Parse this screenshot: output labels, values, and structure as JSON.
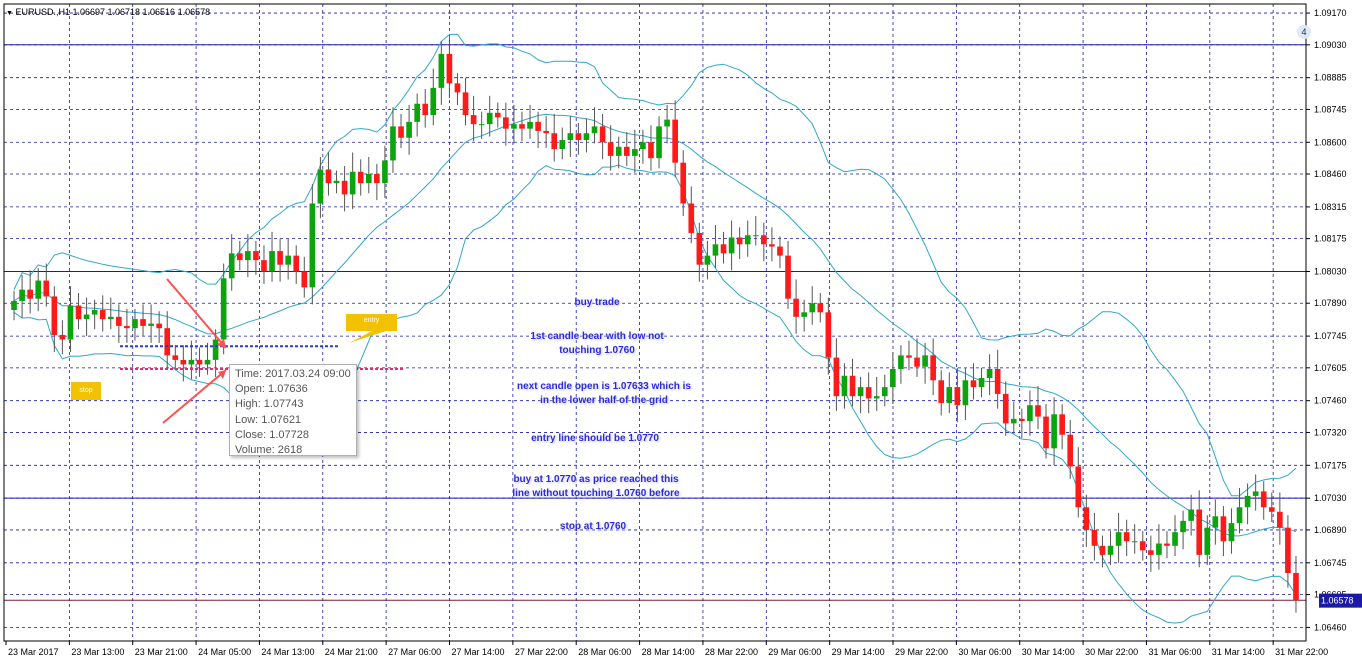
{
  "window": {
    "symbol": "EURUSD.",
    "timeframe": "H1",
    "title": "EURUSD.,H1  1.06697 1.06718 1.06516 1.06578",
    "chart_number": "4"
  },
  "colors": {
    "background": "#ffffff",
    "grid": "#1a1aa6",
    "bull": "#0da30d",
    "bear": "#ff1a1a",
    "bands": "#30a8c8",
    "current_price_bg": "#1a1aa6",
    "annotation_text": "#2b2bd6",
    "arrow": "#ff5050",
    "tag": "#f2c200"
  },
  "price_axis": {
    "labels": [
      "1.09170",
      "1.09030",
      "1.08885",
      "1.08745",
      "1.08600",
      "1.08460",
      "1.08315",
      "1.08175",
      "1.08030",
      "1.07890",
      "1.07745",
      "1.07605",
      "1.07460",
      "1.07320",
      "1.07175",
      "1.07030",
      "1.06890",
      "1.06745",
      "1.06605",
      "1.06460"
    ],
    "current_price": "1.06578",
    "range": [
      1.064,
      1.0921
    ]
  },
  "time_axis": {
    "labels": [
      "23 Mar 2017",
      "23 Mar 13:00",
      "23 Mar 21:00",
      "24 Mar 05:00",
      "24 Mar 13:00",
      "24 Mar 21:00",
      "27 Mar 06:00",
      "27 Mar 14:00",
      "27 Mar 22:00",
      "28 Mar 06:00",
      "28 Mar 14:00",
      "28 Mar 22:00",
      "29 Mar 06:00",
      "29 Mar 14:00",
      "29 Mar 22:00",
      "30 Mar 06:00",
      "30 Mar 14:00",
      "30 Mar 22:00",
      "31 Mar 06:00",
      "31 Mar 14:00",
      "31 Mar 22:00"
    ]
  },
  "horizontal_lines": [
    1.0903,
    1.0803,
    1.0703,
    1.0658
  ],
  "tooltip": {
    "time": "Time: 2017.03.24 09:00",
    "open": "Open: 1.07636",
    "high": "High: 1.07743",
    "low": "Low:  1.07621",
    "close": "Close: 1.07728",
    "volume": "Volume: 2618"
  },
  "annotations": {
    "buy_trade": "buy trade",
    "first_candle_1": "1st candle bear with low not",
    "first_candle_2": "touching 1.0760",
    "next_candle_1": "next candle open is 1.07633 which is",
    "next_candle_2": "in the lower half of the grid",
    "entry_line": "entry line should be 1.0770",
    "buy_at_1": "buy at 1.0770 as price reached this",
    "buy_at_2": "line without touching 1.0760 before",
    "stop_at": "stop at 1.0760",
    "entry_tag": "entry",
    "stop_tag": "stop"
  },
  "levels": {
    "entry": 1.077,
    "stop": 1.076
  },
  "chart_data": {
    "type": "candlestick",
    "symbol": "EURUSD.",
    "timeframe": "H1",
    "ohlc_last": {
      "open": 1.06697,
      "high": 1.06718,
      "low": 1.06516,
      "close": 1.06578
    },
    "ylim": [
      1.064,
      1.0921
    ],
    "close_series": [
      1.079,
      1.0795,
      1.0791,
      1.0799,
      1.0792,
      1.0775,
      1.0773,
      1.0788,
      1.0782,
      1.0784,
      1.0786,
      1.0782,
      1.0783,
      1.0779,
      1.0778,
      1.0782,
      1.0779,
      1.078,
      1.0778,
      1.0766,
      1.0764,
      1.0762,
      1.0764,
      1.0762,
      1.0764,
      1.0773,
      1.08,
      1.0811,
      1.0808,
      1.0812,
      1.0808,
      1.0803,
      1.0812,
      1.0806,
      1.081,
      1.0803,
      1.0796,
      1.0833,
      1.0848,
      1.0842,
      1.0843,
      1.0837,
      1.0847,
      1.0842,
      1.0846,
      1.0842,
      1.0852,
      1.0867,
      1.0862,
      1.0869,
      1.0877,
      1.0872,
      1.0884,
      1.0899,
      1.0886,
      1.0882,
      1.0872,
      1.0868,
      1.0868,
      1.0873,
      1.0871,
      1.0866,
      1.0868,
      1.0866,
      1.0869,
      1.0865,
      1.0864,
      1.0857,
      1.0861,
      1.0864,
      1.0861,
      1.0864,
      1.0867,
      1.086,
      1.0854,
      1.0858,
      1.0854,
      1.0857,
      1.086,
      1.0853,
      1.0867,
      1.087,
      1.0851,
      1.0833,
      1.082,
      1.0806,
      1.081,
      1.0815,
      1.0811,
      1.0818,
      1.0815,
      1.0819,
      1.0819,
      1.0815,
      1.0814,
      1.081,
      1.0791,
      1.0783,
      1.0785,
      1.0789,
      1.0785,
      1.0765,
      1.0748,
      1.0757,
      1.0748,
      1.0752,
      1.0747,
      1.0748,
      1.0752,
      1.076,
      1.0766,
      1.0765,
      1.0761,
      1.0766,
      1.0755,
      1.0745,
      1.0752,
      1.0744,
      1.0755,
      1.0752,
      1.0756,
      1.076,
      1.0749,
      1.0736,
      1.0738,
      1.0737,
      1.0744,
      1.0739,
      1.0725,
      1.074,
      1.0731,
      1.0717,
      1.0699,
      1.0689,
      1.0682,
      1.0678,
      1.0682,
      1.0688,
      1.0684,
      1.0684,
      1.068,
      1.0678,
      1.0683,
      1.0682,
      1.0688,
      1.0693,
      1.0698,
      1.0678,
      1.069,
      1.0695,
      1.0684,
      1.0692,
      1.0699,
      1.0704,
      1.0706,
      1.0699,
      1.0697,
      1.069,
      1.067,
      1.0658
    ]
  }
}
